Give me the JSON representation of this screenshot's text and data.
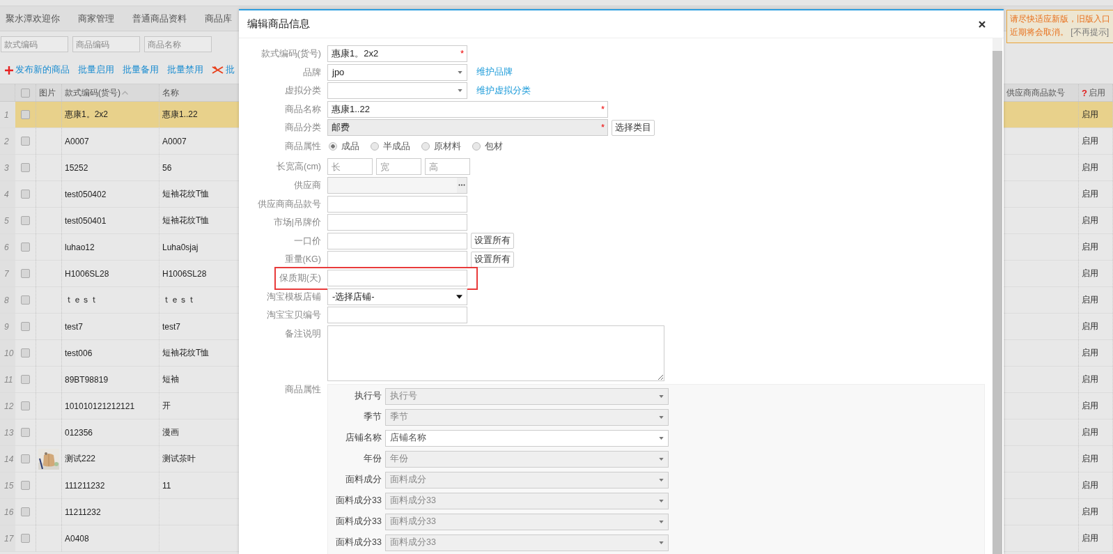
{
  "top_nav": {
    "items": [
      {
        "label": "聚水潭欢迎你"
      },
      {
        "label": "商家管理"
      },
      {
        "label": "普通商品资料"
      },
      {
        "label": "商品库"
      }
    ]
  },
  "filters": [
    {
      "placeholder": "款式编码"
    },
    {
      "placeholder": "商品编码"
    },
    {
      "placeholder": "商品名称"
    }
  ],
  "toolbar": [
    {
      "kind": "add",
      "label": "发布新的商品"
    },
    {
      "kind": "link",
      "label": "批量启用"
    },
    {
      "kind": "link",
      "label": "批量备用"
    },
    {
      "kind": "link",
      "label": "批量禁用"
    },
    {
      "kind": "delete",
      "label": "批"
    }
  ],
  "notice": {
    "text": "请尽快适应新版，旧版入口近期将会取消。",
    "dismiss": "[不再提示]"
  },
  "table": {
    "header_checked": false,
    "columns": [
      {
        "label": "图片",
        "sorted": false
      },
      {
        "label": "款式编码(货号)",
        "sorted": true
      },
      {
        "label": "名称",
        "sorted": false
      },
      {
        "label": "供应商商品款号",
        "sorted": false
      },
      {
        "label": "启用",
        "sorted": false,
        "help_mark": "?"
      }
    ],
    "rows": [
      {
        "index": "1",
        "selected": true,
        "checked": false,
        "has_picture": false,
        "code": "惠康1。2x2",
        "name": "惠康1..22",
        "status": "启用"
      },
      {
        "index": "2",
        "selected": false,
        "checked": false,
        "has_picture": false,
        "code": "A0007",
        "name": "A0007",
        "status": "启用"
      },
      {
        "index": "3",
        "selected": false,
        "checked": false,
        "has_picture": false,
        "code": "15252",
        "name": "56",
        "status": "启用"
      },
      {
        "index": "4",
        "selected": false,
        "checked": false,
        "has_picture": false,
        "code": "test050402",
        "name": "短袖花纹T恤",
        "status": "启用"
      },
      {
        "index": "5",
        "selected": false,
        "checked": false,
        "has_picture": false,
        "code": "test050401",
        "name": "短袖花纹T恤",
        "status": "启用"
      },
      {
        "index": "6",
        "selected": false,
        "checked": false,
        "has_picture": false,
        "code": "luhao12",
        "name": "Luha0sjaj",
        "status": "启用"
      },
      {
        "index": "7",
        "selected": false,
        "checked": false,
        "has_picture": false,
        "code": "H1006SL28",
        "name": "H1006SL28",
        "status": "启用"
      },
      {
        "index": "8",
        "selected": false,
        "checked": false,
        "has_picture": false,
        "code": "ｔｅｓｔ",
        "name": "ｔｅｓｔ",
        "status": "启用"
      },
      {
        "index": "9",
        "selected": false,
        "checked": false,
        "has_picture": false,
        "code": "test7",
        "name": "test7",
        "status": "启用"
      },
      {
        "index": "10",
        "selected": false,
        "checked": false,
        "has_picture": false,
        "code": "test006",
        "name": "短袖花纹T恤",
        "status": "启用"
      },
      {
        "index": "11",
        "selected": false,
        "checked": false,
        "has_picture": false,
        "code": "89BT98819",
        "name": "短袖",
        "status": "启用"
      },
      {
        "index": "12",
        "selected": false,
        "checked": false,
        "has_picture": false,
        "code": "101010121212121",
        "name": "开",
        "status": "启用"
      },
      {
        "index": "13",
        "selected": false,
        "checked": false,
        "has_picture": false,
        "code": "012356",
        "name": "漫画",
        "status": "启用"
      },
      {
        "index": "14",
        "selected": false,
        "checked": false,
        "has_picture": true,
        "code": "测试222",
        "name": "测试茶叶",
        "status": "启用"
      },
      {
        "index": "15",
        "selected": false,
        "checked": false,
        "has_picture": false,
        "code": "111211232",
        "name": "11",
        "status": "启用"
      },
      {
        "index": "16",
        "selected": false,
        "checked": false,
        "has_picture": false,
        "code": "11211232",
        "status": "启用"
      },
      {
        "index": "17",
        "selected": false,
        "checked": false,
        "has_picture": false,
        "code": "A0408",
        "status": "启用"
      }
    ]
  },
  "dialog": {
    "title": "编辑商品信息",
    "fields": [
      {
        "kind": "input",
        "label": "款式编码(货号)",
        "value": "惠康1。2x2",
        "required_mark": "*"
      },
      {
        "kind": "select",
        "label": "品牌",
        "value": "jpo",
        "action": {
          "kind": "link",
          "label": "维护品牌"
        }
      },
      {
        "kind": "select",
        "label": "虚拟分类",
        "action": {
          "kind": "link",
          "label": "维护虚拟分类"
        }
      },
      {
        "kind": "wide-input",
        "label": "商品名称",
        "value": "惠康1..22",
        "required_mark": "*"
      },
      {
        "kind": "wide-input",
        "label": "商品分类",
        "value": "邮费",
        "required_mark": "*",
        "readonly": true,
        "action": {
          "kind": "button",
          "label": "选择类目"
        }
      },
      {
        "kind": "radios",
        "label": "商品属性",
        "options": [
          {
            "label": "成品",
            "selected": true
          },
          {
            "label": "半成品",
            "selected": false
          },
          {
            "label": "原材料",
            "selected": false
          },
          {
            "label": "包材",
            "selected": false
          }
        ]
      },
      {
        "kind": "dims",
        "label": "长宽高(cm)",
        "parts": [
          {
            "placeholder": "长"
          },
          {
            "placeholder": "宽"
          },
          {
            "placeholder": "高"
          }
        ]
      },
      {
        "kind": "picker",
        "label": "供应商"
      },
      {
        "kind": "input",
        "label": "供应商商品款号"
      },
      {
        "kind": "input",
        "label": "市场|吊牌价"
      },
      {
        "kind": "input",
        "label": "一口价",
        "action": {
          "kind": "button",
          "label": "设置所有"
        }
      },
      {
        "kind": "input",
        "label": "重量(KG)",
        "action": {
          "kind": "button",
          "label": "设置所有"
        }
      },
      {
        "kind": "input",
        "label": "保质期(天)",
        "highlighted": true
      },
      {
        "kind": "store-select",
        "label": "淘宝模板店铺",
        "value": "-选择店铺-"
      },
      {
        "kind": "input",
        "label": "淘宝宝贝编号"
      },
      {
        "kind": "textarea",
        "label": "备注说明"
      },
      {
        "kind": "attributes",
        "label": "商品属性",
        "items": [
          {
            "label": "执行号",
            "placeholder": "执行号",
            "disabled": true
          },
          {
            "label": "季节",
            "placeholder": "季节",
            "disabled": true
          },
          {
            "label": "店铺名称",
            "placeholder": "店铺名称",
            "disabled": false
          },
          {
            "label": "年份",
            "placeholder": "年份",
            "disabled": true
          },
          {
            "label": "面料成分",
            "placeholder": "面料成分",
            "disabled": true
          },
          {
            "label": "面料成分33",
            "placeholder": "面料成分33",
            "disabled": true
          },
          {
            "label": "面料成分33",
            "placeholder": "面料成分33",
            "disabled": true
          },
          {
            "label": "面料成分33",
            "placeholder": "面料成分33",
            "disabled": true
          }
        ]
      }
    ]
  }
}
